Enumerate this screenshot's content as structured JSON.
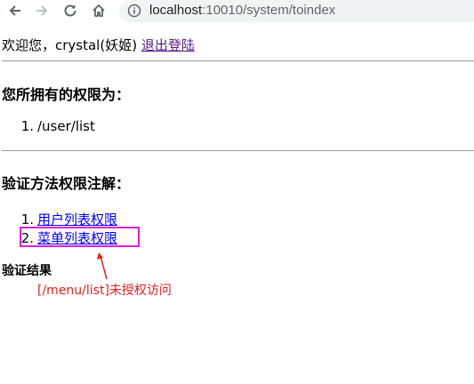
{
  "browser": {
    "url_host": "localhost",
    "url_path": ":10010/system/toindex"
  },
  "page": {
    "welcome_prefix": "欢迎您，crystal(妖姬)",
    "logout_link": "退出登陆",
    "permissions_heading": "您所拥有的权限为：",
    "permissions": [
      {
        "num": "1.",
        "text": "/user/list"
      }
    ],
    "annotations_heading": "验证方法权限注解：",
    "annotation_links": [
      {
        "num": "1.",
        "text": "用户列表权限"
      },
      {
        "num": "2.",
        "text": "菜单列表权限"
      }
    ],
    "result_label": "验证结果",
    "result_message": "[/menu/list]未授权访问"
  },
  "colors": {
    "highlight_box": "#e01be0",
    "result_text": "#e02020",
    "link": "#0000ee",
    "visited_link": "#551a8b"
  }
}
